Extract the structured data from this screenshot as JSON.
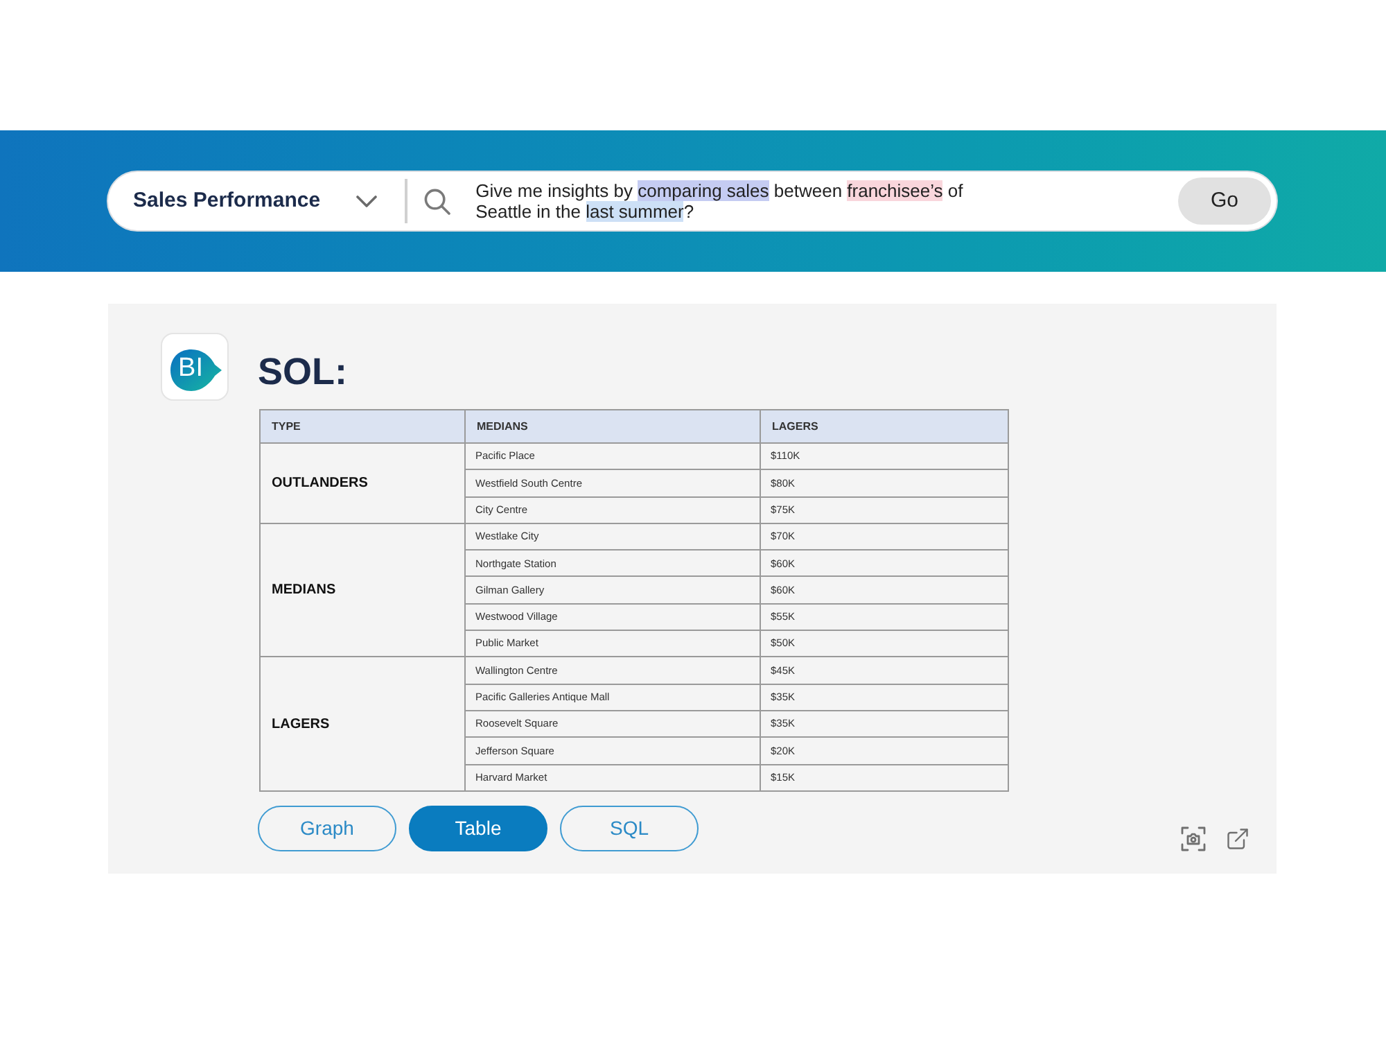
{
  "search_bar": {
    "dataset": "Sales Performance",
    "query_lines": [
      [
        {
          "text": "Give me insights by "
        },
        {
          "text": "comparing sales",
          "color": "#c5ccf2"
        },
        {
          "text": " between "
        },
        {
          "text": "franchisee’s",
          "color": "#f9d6dc"
        },
        {
          "text": " of"
        }
      ],
      [
        {
          "text": "Seattle in the "
        },
        {
          "text": "last summer",
          "color": "#cde0f6"
        },
        {
          "text": "?"
        }
      ]
    ],
    "submit": "Go"
  },
  "result": {
    "logo": "BI",
    "title": "SOL:",
    "table": {
      "columns": [
        "TYPE",
        "MEDIANS",
        "LAGERS"
      ],
      "groups": [
        {
          "type": "OUTLANDERS",
          "rows": [
            [
              "Pacific Place",
              "$110K"
            ],
            [
              "Westfield South Centre",
              "$80K"
            ],
            [
              "City Centre",
              "$75K"
            ]
          ]
        },
        {
          "type": "MEDIANS",
          "rows": [
            [
              "Westlake City",
              "$70K"
            ],
            [
              "Northgate Station",
              "$60K"
            ],
            [
              "Gilman Gallery",
              "$60K"
            ],
            [
              "Westwood Village",
              "$55K"
            ],
            [
              "Public Market",
              "$50K"
            ]
          ]
        },
        {
          "type": "LAGERS",
          "rows": [
            [
              "Wallington Centre",
              "$45K"
            ],
            [
              "Pacific Galleries Antique Mall",
              "$35K"
            ],
            [
              "Roosevelt Square",
              "$35K"
            ],
            [
              "Jefferson Square",
              "$20K"
            ],
            [
              "Harvard Market",
              "$15K"
            ]
          ]
        }
      ]
    },
    "view_tabs": [
      {
        "label": "Graph",
        "selected": false
      },
      {
        "label": "Table",
        "selected": true
      },
      {
        "label": "SQL",
        "selected": false
      }
    ]
  }
}
